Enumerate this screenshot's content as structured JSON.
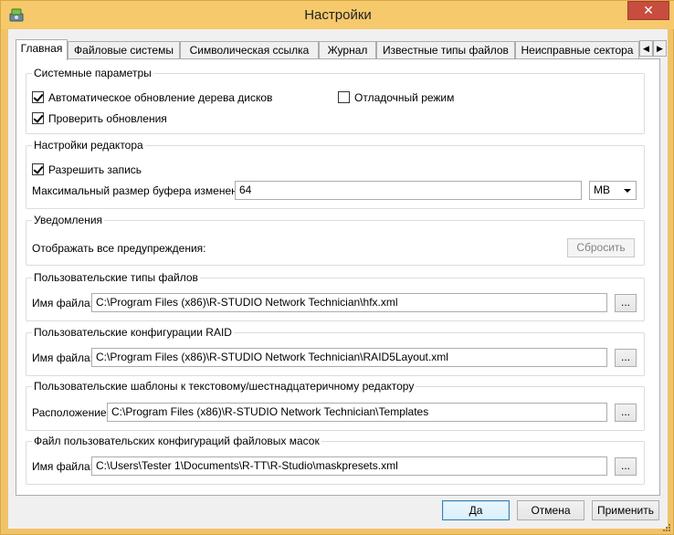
{
  "window": {
    "title": "Настройки",
    "close_label": "✕"
  },
  "tabs": [
    {
      "label": "Главная"
    },
    {
      "label": "Файловые системы"
    },
    {
      "label": "Символическая ссылка"
    },
    {
      "label": "Журнал"
    },
    {
      "label": "Известные типы файлов"
    },
    {
      "label": "Неисправные сектора"
    }
  ],
  "tab_scroll": {
    "left": "◀",
    "right": "▶"
  },
  "system": {
    "title": "Системные параметры",
    "auto_update": {
      "label": "Автоматическое обновление дерева дисков",
      "checked": true
    },
    "debug_mode": {
      "label": "Отладочный режим",
      "checked": false
    },
    "check_updates": {
      "label": "Проверить обновления",
      "checked": true
    }
  },
  "editor": {
    "title": "Настройки редактора",
    "allow_write": {
      "label": "Разрешить запись",
      "checked": true
    },
    "buffer_label": "Максимальный размер буфера изменений:",
    "buffer_value": "64",
    "buffer_unit": "MB"
  },
  "notifications": {
    "title": "Уведомления",
    "show_all_label": "Отображать все предупреждения:",
    "reset_label": "Сбросить"
  },
  "custom_file_types": {
    "title": "Пользовательские типы файлов",
    "label": "Имя файла:",
    "value": "C:\\Program Files (x86)\\R-STUDIO Network Technician\\hfx.xml",
    "browse": "..."
  },
  "raid_configs": {
    "title": "Пользовательские конфигурации RAID",
    "label": "Имя файла:",
    "value": "C:\\Program Files (x86)\\R-STUDIO Network Technician\\RAID5Layout.xml",
    "browse": "..."
  },
  "editor_templates": {
    "title": "Пользовательские шаблоны к текстовому/шестнадцатеричному редактору",
    "label": "Расположение:",
    "value": "C:\\Program Files (x86)\\R-STUDIO Network Technician\\Templates",
    "browse": "..."
  },
  "mask_presets": {
    "title": "Файл пользовательских конфигураций файловых масок",
    "label": "Имя файла:",
    "value": "C:\\Users\\Tester 1\\Documents\\R-TT\\R-Studio\\maskpresets.xml",
    "browse": "..."
  },
  "footer": {
    "ok_label": "Да",
    "cancel_label": "Отмена",
    "apply_label": "Применить"
  }
}
